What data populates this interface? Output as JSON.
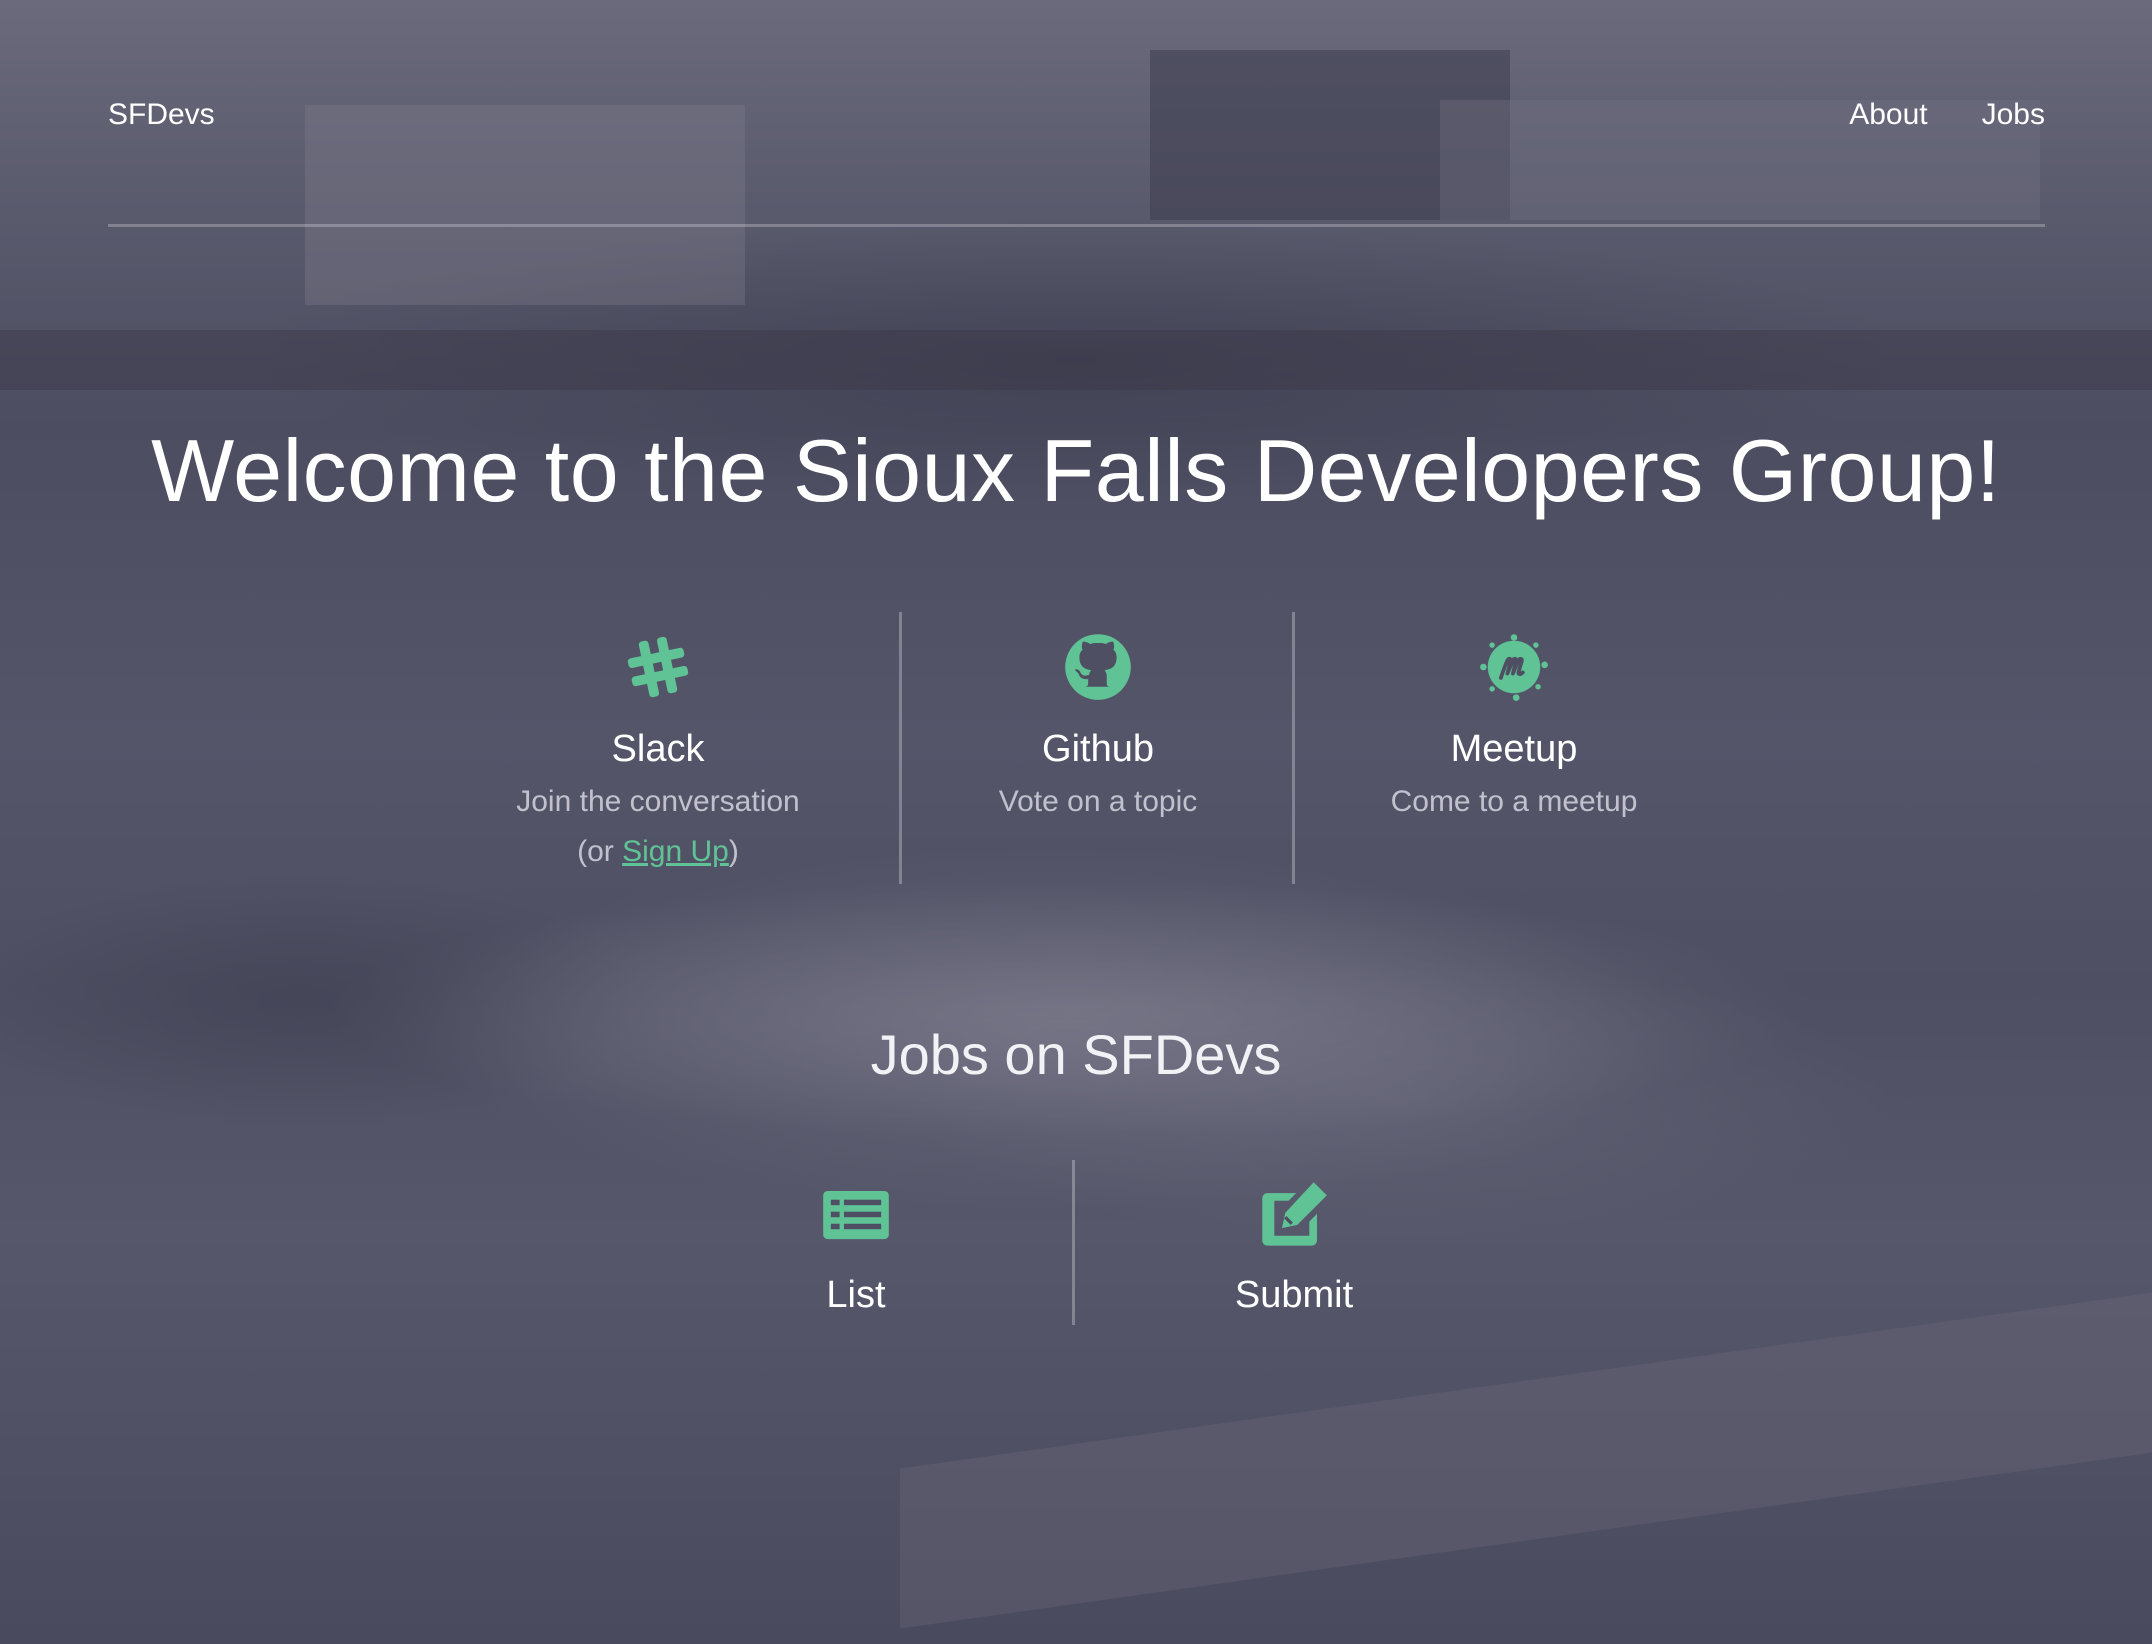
{
  "nav": {
    "brand": "SFDevs",
    "links": [
      "About",
      "Jobs"
    ]
  },
  "hero": {
    "title": "Welcome to the Sioux Falls Developers Group!"
  },
  "features": [
    {
      "icon": "slack-hash-icon",
      "title": "Slack",
      "desc": "Join the conversation",
      "sub_prefix": "(or ",
      "sub_link": "Sign Up",
      "sub_suffix": ")"
    },
    {
      "icon": "github-icon",
      "title": "Github",
      "desc": "Vote on a topic"
    },
    {
      "icon": "meetup-icon",
      "title": "Meetup",
      "desc": "Come to a meetup"
    }
  ],
  "jobs": {
    "heading": "Jobs on SFDevs",
    "items": [
      {
        "icon": "list-icon",
        "label": "List"
      },
      {
        "icon": "edit-icon",
        "label": "Submit"
      }
    ]
  },
  "colors": {
    "accent": "#5fc395",
    "overlay": "#55556a"
  }
}
